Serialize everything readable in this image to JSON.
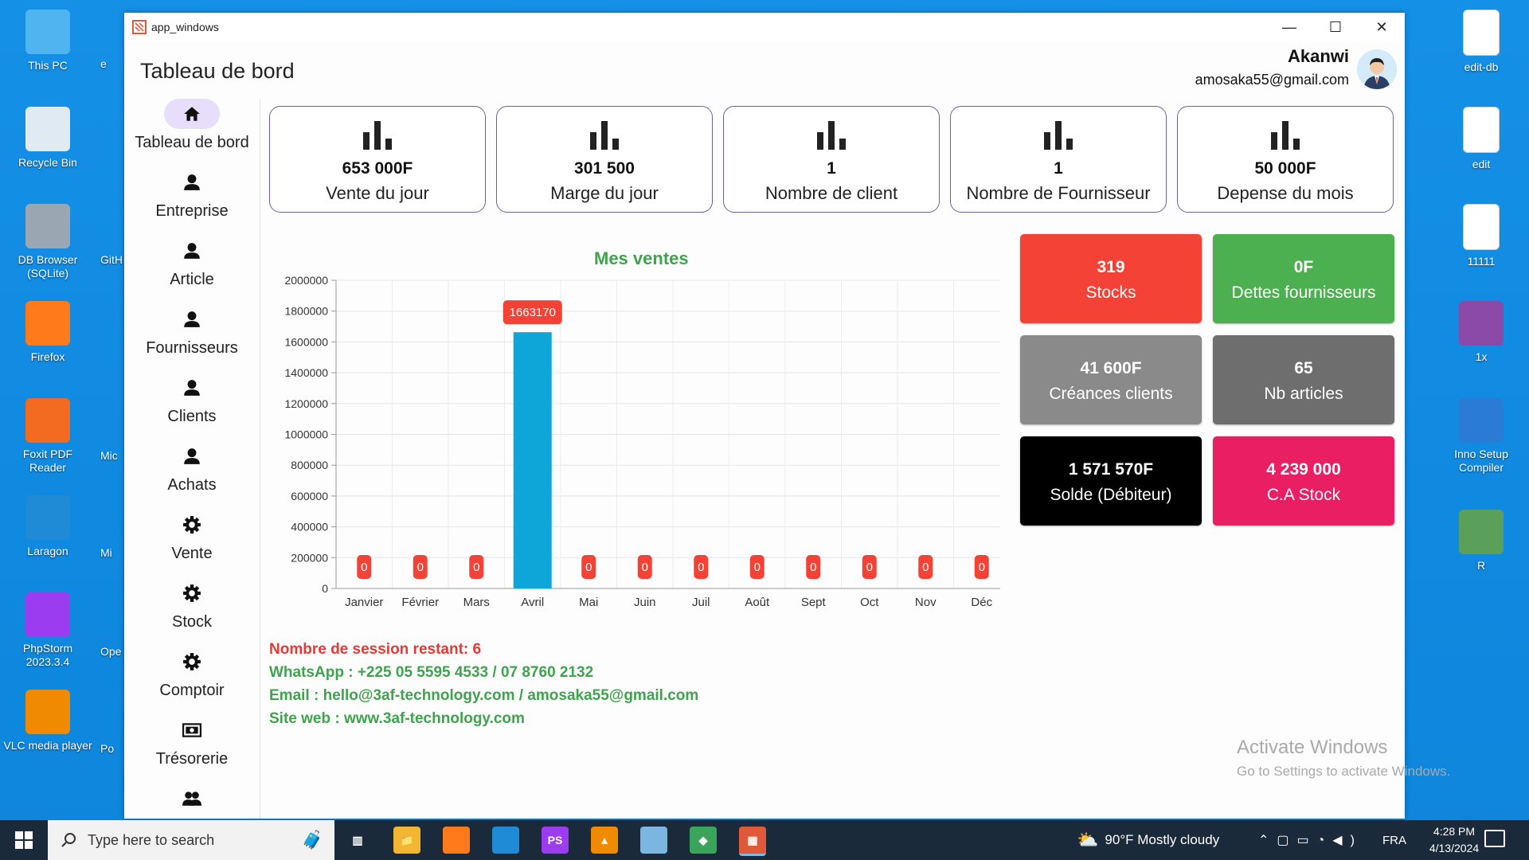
{
  "desktop": {
    "left_icons": [
      {
        "label": "This PC",
        "icon": "monitor-icon"
      },
      {
        "label": "Recycle Bin",
        "icon": "recycle-bin-icon"
      },
      {
        "label": "DB Browser (SQLite)",
        "icon": "database-icon"
      },
      {
        "label": "Firefox",
        "icon": "firefox-icon"
      },
      {
        "label": "Foxit PDF Reader",
        "icon": "pdf-icon"
      },
      {
        "label": "Laragon",
        "icon": "elephant-icon"
      },
      {
        "label": "PhpStorm 2023.3.4",
        "icon": "phpstorm-icon"
      },
      {
        "label": "VLC media player",
        "icon": "vlc-cone-icon"
      }
    ],
    "partial_labels": [
      "e",
      "GitH",
      "Mic",
      "Mi",
      "Ope",
      "Po"
    ],
    "right_icons": [
      {
        "label": "edit-db",
        "icon": "document-icon"
      },
      {
        "label": "edit",
        "icon": "document-icon"
      },
      {
        "label": "11111",
        "icon": "document-icon"
      },
      {
        "label": "1x",
        "icon": "winrar-icon"
      },
      {
        "label": "Inno Setup Compiler",
        "icon": "inno-setup-icon"
      },
      {
        "label": "R",
        "icon": "image-icon"
      }
    ]
  },
  "window": {
    "title": "app_windows",
    "controls": {
      "minimize": "—",
      "maximize": "☐",
      "close": "✕"
    }
  },
  "header": {
    "page_title": "Tableau de bord",
    "user_name": "Akanwi",
    "user_email": "amosaka55@gmail.com"
  },
  "sidebar": {
    "items": [
      {
        "label": "Tableau de bord",
        "icon": "home-icon",
        "active": true
      },
      {
        "label": "Entreprise",
        "icon": "person-icon"
      },
      {
        "label": "Article",
        "icon": "person-icon"
      },
      {
        "label": "Fournisseurs",
        "icon": "person-icon"
      },
      {
        "label": "Clients",
        "icon": "person-icon"
      },
      {
        "label": "Achats",
        "icon": "person-icon"
      },
      {
        "label": "Vente",
        "icon": "gear-icon"
      },
      {
        "label": "Stock",
        "icon": "gear-icon"
      },
      {
        "label": "Comptoir",
        "icon": "gear-icon"
      },
      {
        "label": "Trésorerie",
        "icon": "cash-icon"
      },
      {
        "label": "",
        "icon": "group-icon"
      }
    ]
  },
  "kpis": [
    {
      "value": "653 000F",
      "label": "Vente du jour"
    },
    {
      "value": "301 500",
      "label": "Marge du jour"
    },
    {
      "value": "1",
      "label": "Nombre de client"
    },
    {
      "value": "1",
      "label": "Nombre de Fournisseur"
    },
    {
      "value": "50 000F",
      "label": "Depense du mois"
    }
  ],
  "tiles": [
    {
      "value": "319",
      "label": "Stocks",
      "color": "#f44336"
    },
    {
      "value": "0F",
      "label": "Dettes fournisseurs",
      "color": "#4caf50"
    },
    {
      "value": "41 600F",
      "label": "Créances clients",
      "color": "#8a8a8a"
    },
    {
      "value": "65",
      "label": "Nb articles",
      "color": "#6e6e6e"
    },
    {
      "value": "1 571 570F",
      "label": "Solde (Débiteur)",
      "color": "#000000"
    },
    {
      "value": "4 239 000",
      "label": "C.A Stock",
      "color": "#e91e63"
    }
  ],
  "info": {
    "sessions": "Nombre de session restant: 6",
    "whatsapp": "WhatsApp : +225 05 5595 4533 / 07 8760 2132",
    "email": "Email : hello@3af-technology.com / amosaka55@gmail.com",
    "website": "Site web : www.3af-technology.com"
  },
  "watermark": {
    "line1": "Activate Windows",
    "line2": "Go to Settings to activate Windows."
  },
  "taskbar": {
    "search_placeholder": "Type here to search",
    "apps": [
      "task-view-icon",
      "file-explorer-icon",
      "firefox-icon",
      "vscode-icon",
      "phpstorm-icon",
      "vlc-icon",
      "notepad-icon",
      "git-icon",
      "app-windows-icon"
    ],
    "weather": "90°F  Mostly cloudy",
    "language": "FRA",
    "time": "4:28 PM",
    "date": "4/13/2024"
  },
  "colors": {
    "bar": "#0ea5d9",
    "label_badge": "#f44336",
    "chart_title": "#3fa34d",
    "kpi_border": "#6b5fa8",
    "active_nav": "#e6defa"
  },
  "chart_data": {
    "type": "bar",
    "title": "Mes ventes",
    "categories": [
      "Janvier",
      "Février",
      "Mars",
      "Avril",
      "Mai",
      "Juin",
      "Juil",
      "Août",
      "Sept",
      "Oct",
      "Nov",
      "Déc"
    ],
    "values": [
      0,
      0,
      0,
      1663170,
      0,
      0,
      0,
      0,
      0,
      0,
      0,
      0
    ],
    "ylim": [
      0,
      2000000
    ],
    "yticks": [
      0,
      200000,
      400000,
      600000,
      800000,
      1000000,
      1200000,
      1400000,
      1600000,
      1800000,
      2000000
    ],
    "grid": true,
    "data_labels": true
  }
}
